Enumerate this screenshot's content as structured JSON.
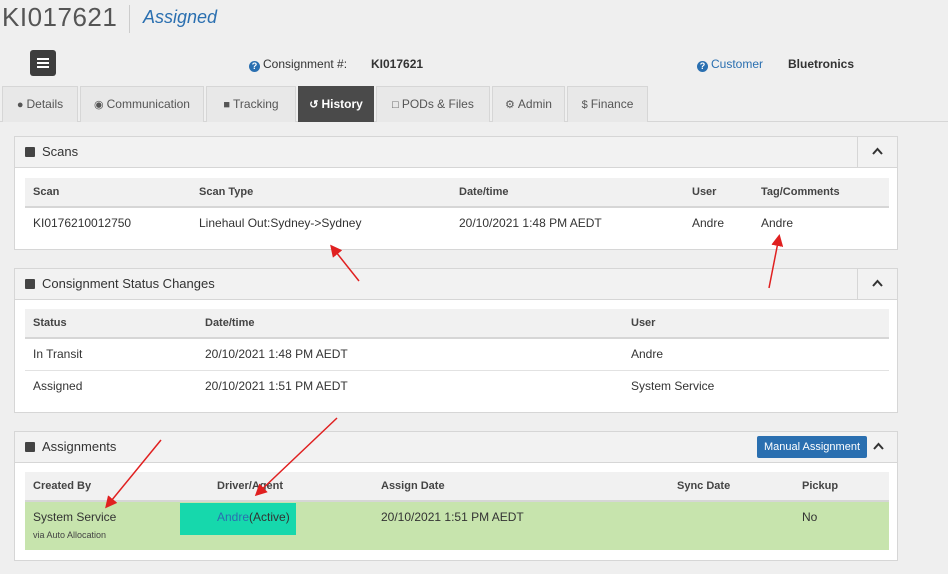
{
  "header": {
    "ref": "KI017621",
    "status": "Assigned",
    "consignment_label": "Consignment #:",
    "consignment_value": "KI017621",
    "customer_label": "Customer",
    "customer_value": "Bluetronics"
  },
  "tabs": [
    {
      "label": "Details",
      "icon": "user-icon"
    },
    {
      "label": "Communication",
      "icon": "comment-icon"
    },
    {
      "label": "Tracking",
      "icon": "truck-icon"
    },
    {
      "label": "History",
      "icon": "history-icon",
      "active": true
    },
    {
      "label": "PODs & Files",
      "icon": "file-icon"
    },
    {
      "label": "Admin",
      "icon": "gear-icon"
    },
    {
      "label": "Finance",
      "icon": "dollar-icon"
    }
  ],
  "scans": {
    "title": "Scans",
    "columns": [
      "Scan",
      "Scan Type",
      "Date/time",
      "User",
      "Tag/Comments"
    ],
    "rows": [
      [
        "KI0176210012750",
        "Linehaul Out:Sydney->Sydney",
        "20/10/2021 1:48 PM AEDT",
        "Andre",
        "Andre"
      ]
    ]
  },
  "status_changes": {
    "title": "Consignment Status Changes",
    "columns": [
      "Status",
      "Date/time",
      "User"
    ],
    "rows": [
      [
        "In Transit",
        "20/10/2021 1:48 PM AEDT",
        "Andre"
      ],
      [
        "Assigned",
        "20/10/2021 1:51 PM AEDT",
        "System Service"
      ]
    ]
  },
  "assignments": {
    "title": "Assignments",
    "manual_button": "Manual Assignment",
    "columns": [
      "Created By",
      "Driver/Agent",
      "Assign Date",
      "Sync Date",
      "Pickup"
    ],
    "row": {
      "created_by": "System Service",
      "created_by_note": "via Auto Allocation",
      "driver": "Andre",
      "driver_status": "(Active)",
      "assign_date": "20/10/2021 1:51 PM AEDT",
      "sync_date": "",
      "pickup": "No"
    }
  },
  "colors": {
    "accent": "#2a6fb0",
    "active_tab": "#4a4a4a",
    "assignment_row": "#c7e4ad",
    "driver_highlight": "#16d8ac",
    "annotation_arrow": "#e02020"
  }
}
